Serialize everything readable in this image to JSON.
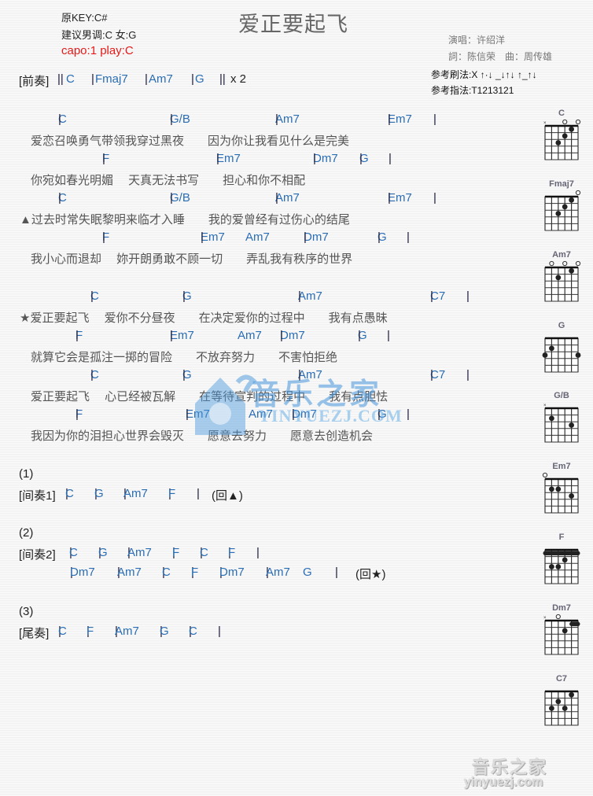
{
  "header": {
    "original_key": "原KEY:C#",
    "suggested_key": "建议男调:C 女:G",
    "capo": "capo:1 play:C",
    "title": "爱正要起飞",
    "singer": "演唱：许绍洋",
    "writers": "詞：陈信荣　曲：周传雄",
    "strum_pattern": "参考刷法:X ↑·↓ _↓↑↓ ↑_↑↓",
    "finger_pattern": "参考指法:T1213121"
  },
  "sections": [
    {
      "label": "[前奏]",
      "tokens": [
        {
          "t": "bar",
          "v": "||"
        },
        {
          "t": "chord",
          "v": "C"
        },
        {
          "t": "bar",
          "v": "|"
        },
        {
          "t": "chord",
          "v": "Fmaj7"
        },
        {
          "t": "bar",
          "v": "|"
        },
        {
          "t": "chord",
          "v": "Am7"
        },
        {
          "t": "bar",
          "v": "|"
        },
        {
          "t": "chord",
          "v": "G"
        },
        {
          "t": "bar",
          "v": "||"
        },
        {
          "t": "text",
          "v": "x 2"
        }
      ]
    }
  ],
  "verse": [
    {
      "chords": [
        [
          "|",
          "C"
        ],
        [
          "|",
          "G/B"
        ],
        [
          "|",
          "Am7"
        ],
        [
          "|",
          "Em7"
        ],
        [
          "|",
          ""
        ]
      ],
      "lyric": "爱恋召唤勇气带领我穿过黑夜　　因为你让我看见什么是完美"
    },
    {
      "chords": [
        [
          "|",
          "F"
        ],
        [
          "|",
          "Em7"
        ],
        [
          "|",
          "Dm7"
        ],
        [
          "|",
          "G"
        ],
        [
          "|",
          ""
        ]
      ],
      "lyric": "你宛如春光明媚　 天真无法书写　　担心和你不相配"
    },
    {
      "chords": [
        [
          "|",
          "C"
        ],
        [
          "|",
          "G/B"
        ],
        [
          "|",
          "Am7"
        ],
        [
          "|",
          "Em7"
        ],
        [
          "|",
          ""
        ]
      ],
      "lyric": "▲过去时常失眠黎明来临才入睡　　我的爱曾经有过伤心的结尾"
    },
    {
      "chords": [
        [
          "|",
          "F"
        ],
        [
          "|",
          "Em7"
        ],
        [
          "",
          "Am7"
        ],
        [
          "|",
          "Dm7"
        ],
        [
          "|",
          "G"
        ],
        [
          "|",
          ""
        ]
      ],
      "lyric": "我小心而退却　 妳开朗勇敢不顾一切　　弄乱我有秩序的世界"
    }
  ],
  "chorus": [
    {
      "chords": [
        [
          "|",
          "C"
        ],
        [
          "|",
          "G"
        ],
        [
          "|",
          "Am7"
        ],
        [
          "|",
          "C7"
        ],
        [
          "|",
          ""
        ]
      ],
      "lyric": "★爱正要起飞　 爱你不分昼夜　　在决定爱你的过程中　　我有点愚昧"
    },
    {
      "chords": [
        [
          "|",
          "F"
        ],
        [
          "|",
          "Em7"
        ],
        [
          "",
          "Am7"
        ],
        [
          "|",
          "Dm7"
        ],
        [
          "|",
          "G"
        ],
        [
          "|",
          ""
        ]
      ],
      "lyric": "就算它会是孤注一掷的冒险　　不放弃努力　　不害怕拒绝"
    },
    {
      "chords": [
        [
          "|",
          "C"
        ],
        [
          "|",
          "G"
        ],
        [
          "|",
          "Am7"
        ],
        [
          "|",
          "C7"
        ],
        [
          "|",
          ""
        ]
      ],
      "lyric": "爱正要起飞　 心已经被瓦解　　在等待宣判的过程中　　我有点胆怯"
    },
    {
      "chords": [
        [
          "|",
          "F"
        ],
        [
          "|",
          "Em7"
        ],
        [
          "",
          "Am7"
        ],
        [
          "|",
          "Dm7"
        ],
        [
          "|",
          "G"
        ],
        [
          "|",
          ""
        ]
      ],
      "lyric": "我因为你的泪担心世界会毁灭　　愿意去努力　　愿意去创造机会"
    }
  ],
  "interludes": [
    {
      "marker": "(1)",
      "label": "[间奏1]",
      "chords": [
        "C",
        "G",
        "Am7",
        "F"
      ],
      "tail": "(回▲)"
    },
    {
      "marker": "(2)",
      "label": "[间奏2]",
      "chords": [
        "C",
        "G",
        "Am7",
        "F",
        "C",
        "F"
      ],
      "line2": [
        "Dm7",
        "Am7",
        "C",
        "F",
        "Dm7",
        "Am7 G"
      ],
      "tail": "(回★)"
    },
    {
      "marker": "(3)",
      "label": "[尾奏]",
      "chords": [
        "C",
        "F",
        "Am7",
        "G",
        "C"
      ]
    }
  ],
  "chord_diagrams": [
    {
      "name": "C",
      "open": [
        3,
        5
      ],
      "muted": [
        0
      ],
      "dots": [
        [
          4,
          1
        ],
        [
          3,
          2
        ],
        [
          2,
          3
        ]
      ],
      "barre": null
    },
    {
      "name": "Fmaj7",
      "open": [
        5
      ],
      "muted": [],
      "dots": [
        [
          4,
          1
        ],
        [
          3,
          2
        ],
        [
          2,
          3
        ]
      ],
      "barre": null
    },
    {
      "name": "Am7",
      "open": [
        1,
        3,
        5
      ],
      "muted": [],
      "dots": [
        [
          4,
          1
        ],
        [
          2,
          2
        ]
      ],
      "barre": null
    },
    {
      "name": "G",
      "open": [],
      "muted": [],
      "dots": [
        [
          1,
          2
        ],
        [
          0,
          3
        ],
        [
          5,
          3
        ]
      ],
      "barre": null
    },
    {
      "name": "G/B",
      "open": [],
      "muted": [
        0
      ],
      "dots": [
        [
          1,
          2
        ],
        [
          4,
          3
        ]
      ],
      "barre": null
    },
    {
      "name": "Em7",
      "open": [
        0
      ],
      "muted": [],
      "dots": [
        [
          1,
          2
        ],
        [
          2,
          2
        ],
        [
          4,
          3
        ]
      ],
      "barre": null
    },
    {
      "name": "F",
      "open": [],
      "muted": [],
      "dots": [
        [
          3,
          2
        ],
        [
          1,
          3
        ],
        [
          2,
          3
        ]
      ],
      "barre": {
        "fret": 1,
        "from": 0,
        "to": 5
      }
    },
    {
      "name": "Dm7",
      "open": [
        2
      ],
      "muted": [
        0
      ],
      "dots": [
        [
          3,
          2
        ]
      ],
      "barre": {
        "fret": 1,
        "from": 4,
        "to": 5
      }
    },
    {
      "name": "C7",
      "open": [],
      "muted": [],
      "dots": [
        [
          4,
          1
        ],
        [
          2,
          2
        ],
        [
          1,
          3
        ],
        [
          3,
          3
        ]
      ],
      "barre": null
    }
  ],
  "watermark": {
    "center_cn": "音乐之家",
    "center_en": "YINYUEZJ.COM",
    "logo_cn": "音乐之家",
    "logo_en": "yinyuezj.com"
  }
}
